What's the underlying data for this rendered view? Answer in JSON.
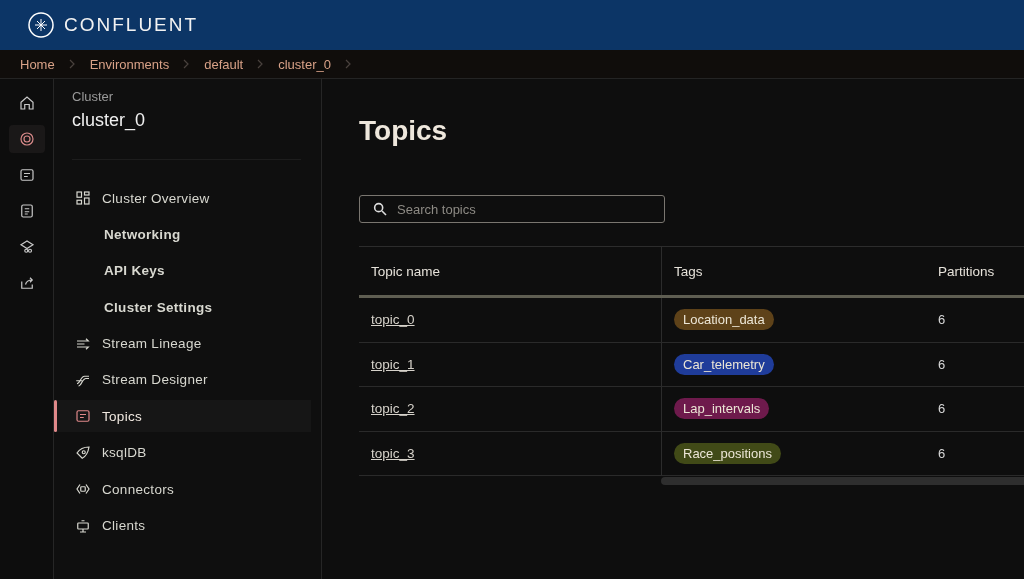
{
  "header": {
    "brand": "CONFLUENT"
  },
  "breadcrumbs": [
    "Home",
    "Environments",
    "default",
    "cluster_0"
  ],
  "rail_items": [
    {
      "selected": false
    },
    {
      "selected": true
    },
    {
      "selected": false
    },
    {
      "selected": false
    },
    {
      "selected": false
    },
    {
      "selected": false
    }
  ],
  "sidebar": {
    "caption": "Cluster",
    "title": "cluster_0",
    "items": [
      {
        "label": "Cluster Overview",
        "kind": "icon",
        "selected": false
      },
      {
        "label": "Networking",
        "kind": "sub",
        "selected": false
      },
      {
        "label": "API Keys",
        "kind": "sub",
        "selected": false
      },
      {
        "label": "Cluster Settings",
        "kind": "sub",
        "selected": false
      },
      {
        "label": "Stream Lineage",
        "kind": "icon",
        "selected": false
      },
      {
        "label": "Stream Designer",
        "kind": "icon",
        "selected": false
      },
      {
        "label": "Topics",
        "kind": "icon",
        "selected": true
      },
      {
        "label": "ksqlDB",
        "kind": "icon",
        "selected": false
      },
      {
        "label": "Connectors",
        "kind": "icon",
        "selected": false
      },
      {
        "label": "Clients",
        "kind": "icon",
        "selected": false
      }
    ]
  },
  "page": {
    "title": "Topics",
    "search": {
      "placeholder": "Search topics"
    }
  },
  "table": {
    "columns": [
      "Topic name",
      "Tags",
      "Partitions"
    ],
    "rows": [
      {
        "name": "topic_0",
        "tag": {
          "label": "Location_data",
          "color": "#5e4219"
        },
        "partitions": "6"
      },
      {
        "name": "topic_1",
        "tag": {
          "label": "Car_telemetry",
          "color": "#1f3c9a"
        },
        "partitions": "6"
      },
      {
        "name": "topic_2",
        "tag": {
          "label": "Lap_intervals",
          "color": "#6e1a4c"
        },
        "partitions": "6"
      },
      {
        "name": "topic_3",
        "tag": {
          "label": "Race_positions",
          "color": "#414a17"
        },
        "partitions": "6"
      }
    ]
  }
}
